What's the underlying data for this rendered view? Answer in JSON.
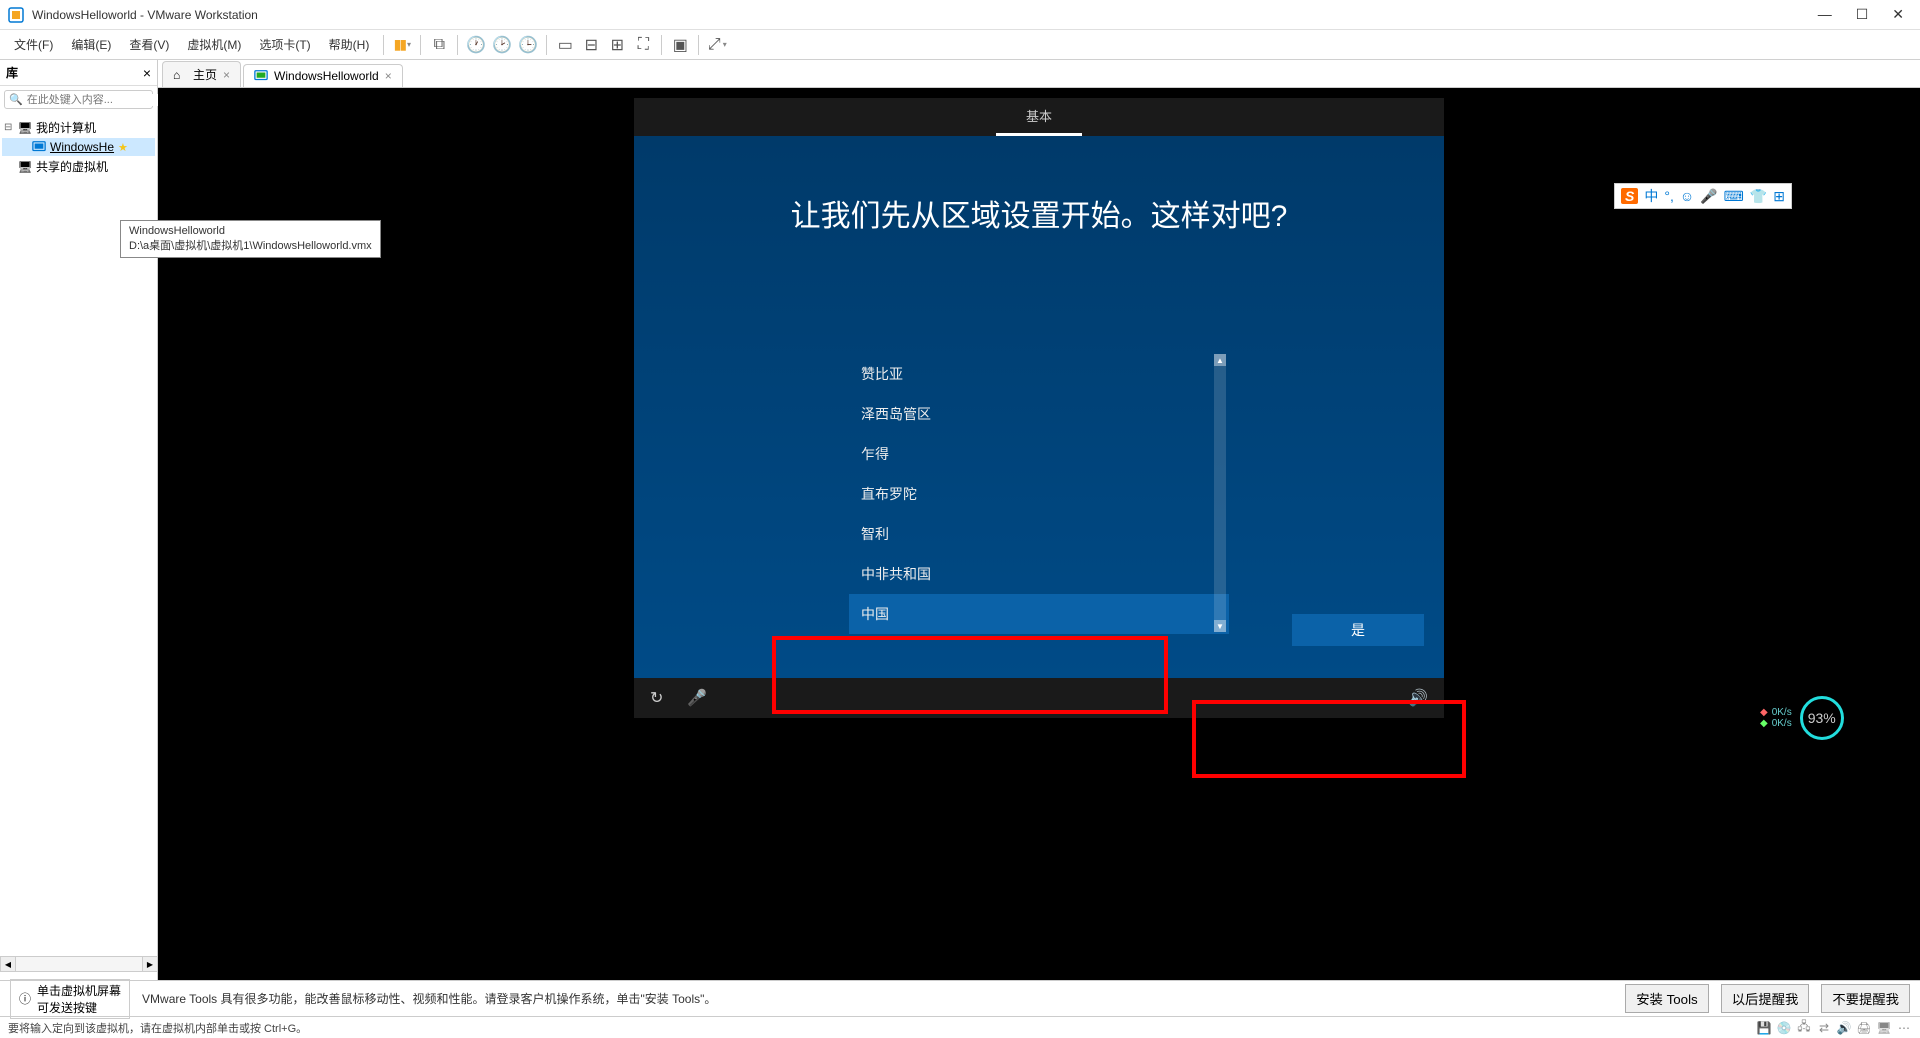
{
  "titlebar": {
    "title": "WindowsHelloworld - VMware Workstation"
  },
  "menu": {
    "file": "文件(F)",
    "edit": "编辑(E)",
    "view": "查看(V)",
    "vm": "虚拟机(M)",
    "tabs": "选项卡(T)",
    "help": "帮助(H)"
  },
  "sidebar": {
    "title": "库",
    "search_placeholder": "在此处键入内容...",
    "my_computer": "我的计算机",
    "vm_name": "WindowsHe",
    "shared": "共享的虚拟机",
    "tooltip_title": "WindowsHelloworld",
    "tooltip_path": "D:\\a桌面\\虚拟机\\虚拟机1\\WindowsHelloworld.vmx"
  },
  "tabs": {
    "home": "主页",
    "vm": "WindowsHelloworld"
  },
  "oobe": {
    "tab": "基本",
    "title": "让我们先从区域设置开始。这样对吧?",
    "regions": [
      "赞比亚",
      "泽西岛管区",
      "乍得",
      "直布罗陀",
      "智利",
      "中非共和国",
      "中国"
    ],
    "selected_index": 6,
    "yes_button": "是"
  },
  "ime": {
    "mode": "中"
  },
  "perf": {
    "up": "0K/s",
    "down": "0K/s",
    "cpu": "93%"
  },
  "info_bar": {
    "hint_line1": "单击虚拟机屏幕",
    "hint_line2": "可发送按键",
    "tools_msg": "VMware Tools 具有很多功能，能改善鼠标移动性、视频和性能。请登录客户机操作系统，单击\"安装 Tools\"。",
    "install": "安装 Tools",
    "later": "以后提醒我",
    "never": "不要提醒我"
  },
  "status": {
    "text": "要将输入定向到该虚拟机，请在虚拟机内部单击或按 Ctrl+G。"
  }
}
